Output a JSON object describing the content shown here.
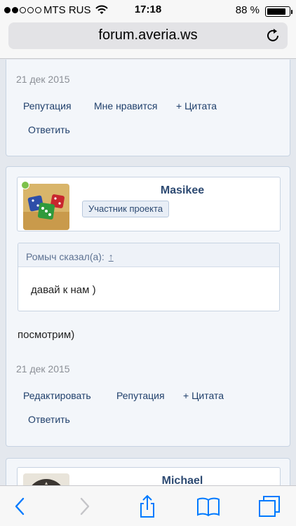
{
  "status": {
    "carrier": "MTS RUS",
    "time": "17:18",
    "battery": "88 %",
    "signal_bars": 2,
    "battery_level": 0.88
  },
  "address": {
    "url": "forum.averia.ws"
  },
  "post1": {
    "date": "21 дек 2015",
    "actions": {
      "reputation": "Репутация",
      "like": "Мне нравится",
      "quote": "+ Цитата",
      "reply": "Ответить"
    }
  },
  "post2": {
    "username": "Masikee",
    "badge": "Участник проекта",
    "quote_author": "Ромыч сказал(а):",
    "quote_arrow": "↑",
    "quote_text": "давай к нам )",
    "message": "посмотрим)",
    "date": "21 дек 2015",
    "actions": {
      "edit": "Редактировать",
      "reputation": "Репутация",
      "quote": "+ Цитата",
      "reply": "Ответить"
    }
  },
  "post3": {
    "username": "Michael"
  },
  "colors": {
    "accent": "#1f3f6b",
    "username": "#2d4a72",
    "ios_blue": "#007aff",
    "online_dot": "#7dc14b"
  },
  "icons": [
    "wifi-icon",
    "battery-icon",
    "reload-icon",
    "back-icon",
    "forward-icon",
    "share-icon",
    "bookmarks-icon",
    "tabs-icon"
  ]
}
